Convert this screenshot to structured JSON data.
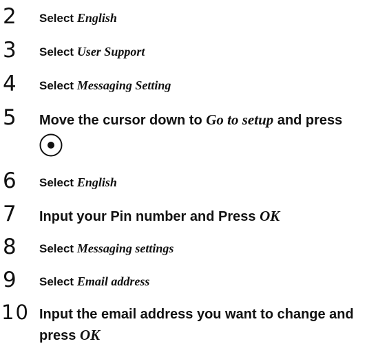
{
  "steps": [
    {
      "number": "2",
      "prefix": "Select ",
      "emphasis": "English",
      "suffix": ""
    },
    {
      "number": "3",
      "prefix": "Select ",
      "emphasis": "User Support",
      "suffix": ""
    },
    {
      "number": "4",
      "prefix": "Select ",
      "emphasis": "Messaging Setting",
      "suffix": ""
    },
    {
      "number": "5",
      "prefix": "Move the cursor down to ",
      "emphasis": "Go to setup",
      "suffix": " and press",
      "icon": "center-select-button-icon"
    },
    {
      "number": "6",
      "prefix": "Select ",
      "emphasis": "English",
      "suffix": ""
    },
    {
      "number": "7",
      "prefix": "Input your Pin number and Press ",
      "emphasis": "OK",
      "suffix": ""
    },
    {
      "number": "8",
      "prefix": "Select ",
      "emphasis": "Messaging settings",
      "suffix": ""
    },
    {
      "number": "9",
      "prefix": "Select ",
      "emphasis": "Email address",
      "suffix": ""
    },
    {
      "number": "10",
      "prefix": "Input the email address you want to change and press ",
      "emphasis": "OK",
      "suffix": ""
    }
  ]
}
